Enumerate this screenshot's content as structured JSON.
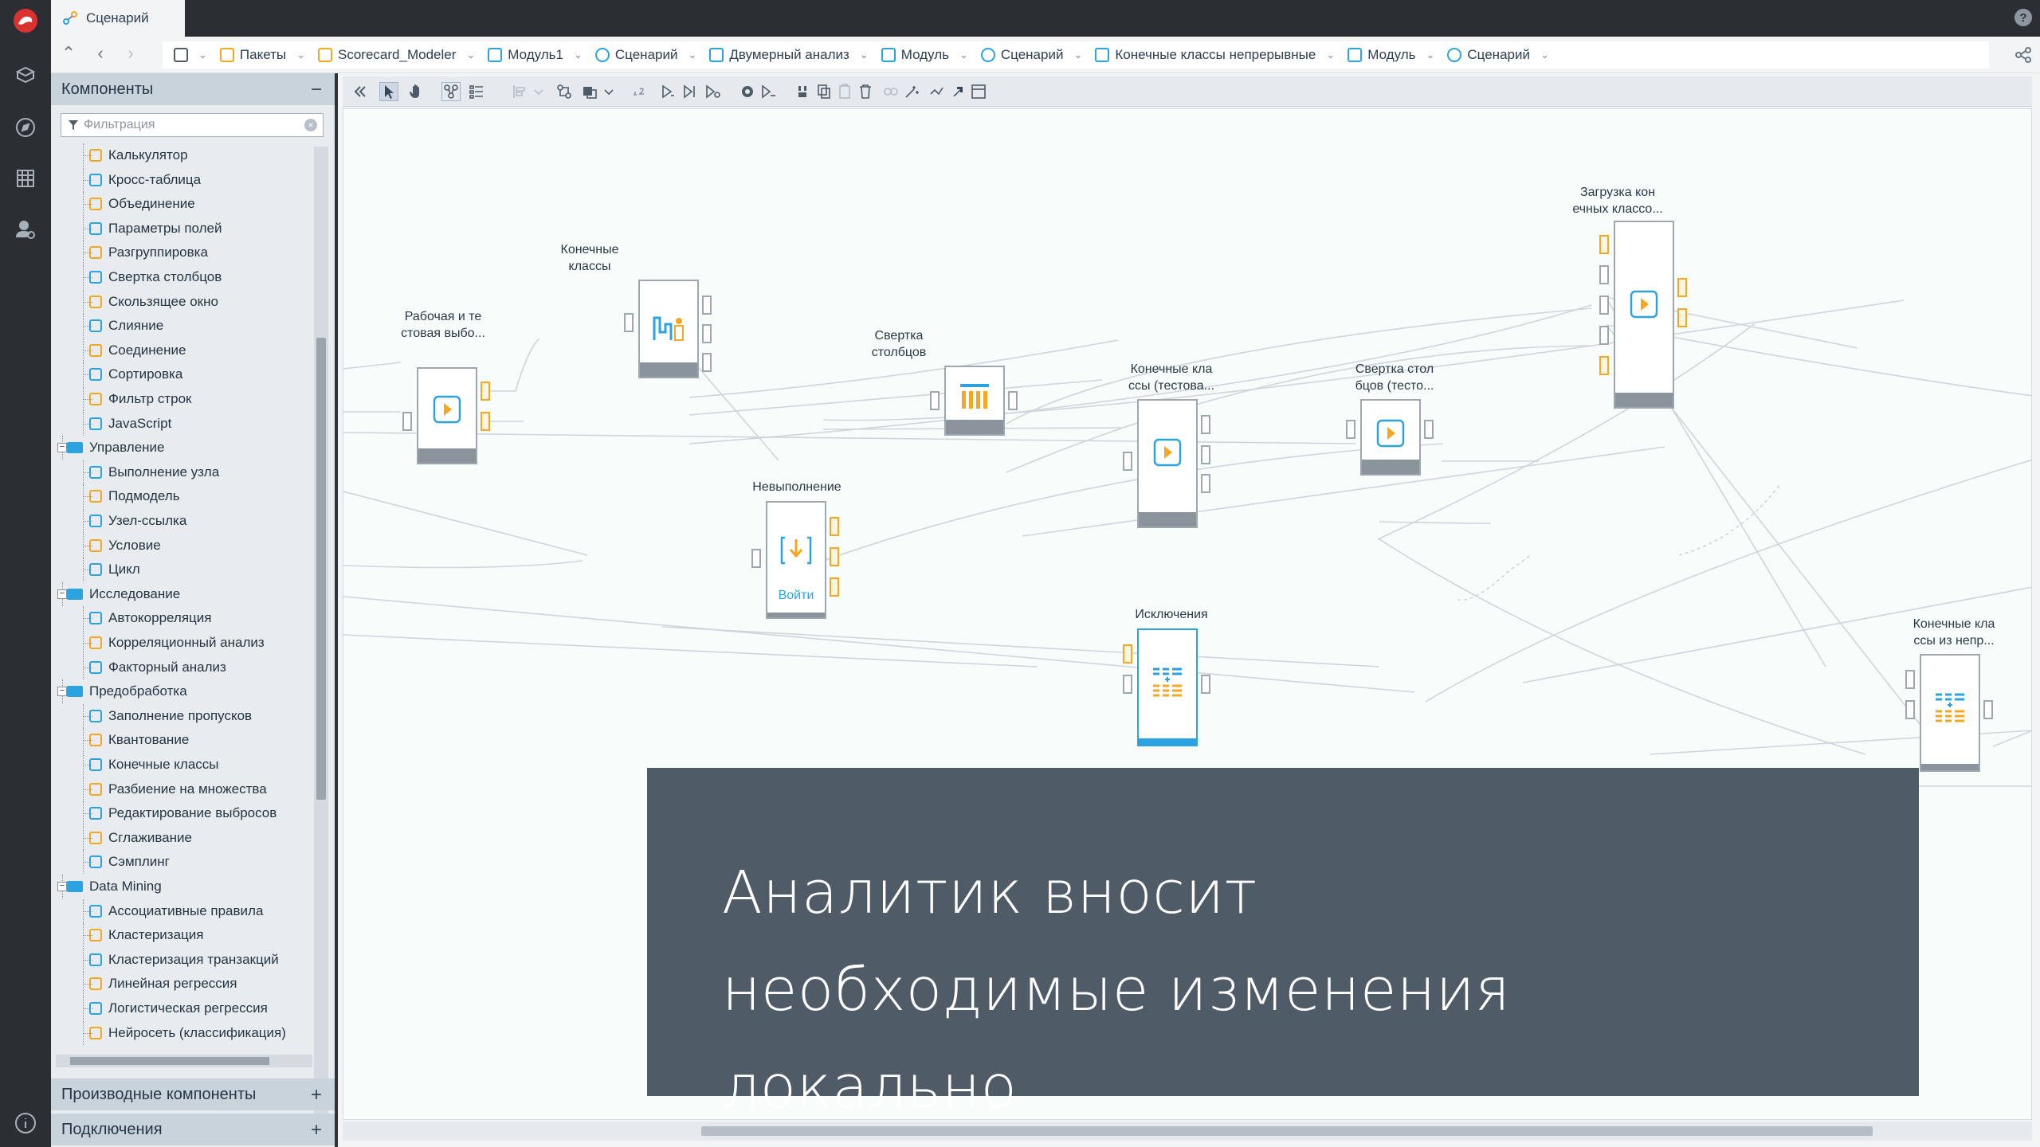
{
  "app": {
    "main_tab": "Сценарий",
    "help": "?"
  },
  "breadcrumb": [
    {
      "label": "",
      "icon": "hierarchy-icon"
    },
    {
      "label": "Пакеты",
      "icon": "package-icon"
    },
    {
      "label": "Scorecard_Modeler",
      "icon": "package-icon"
    },
    {
      "label": "Модуль1",
      "icon": "module-icon"
    },
    {
      "label": "Сценарий",
      "icon": "scenario-icon"
    },
    {
      "label": "Двумерный анализ",
      "icon": "module-icon"
    },
    {
      "label": "Модуль",
      "icon": "module-icon"
    },
    {
      "label": "Сценарий",
      "icon": "scenario-icon"
    },
    {
      "label": "Конечные классы непрерывные",
      "icon": "module-icon"
    },
    {
      "label": "Модуль",
      "icon": "module-icon"
    },
    {
      "label": "Сценарий",
      "icon": "scenario-icon"
    }
  ],
  "sidebar": {
    "components_title": "Компоненты",
    "collapse": "−",
    "filter_placeholder": "Фильтрация",
    "tree": [
      {
        "label": "Калькулятор",
        "level": 2,
        "icon": "calculator-icon"
      },
      {
        "label": "Кросс-таблица",
        "level": 2,
        "icon": "crosstab-icon"
      },
      {
        "label": "Объединение",
        "level": 2,
        "icon": "union-icon"
      },
      {
        "label": "Параметры полей",
        "level": 2,
        "icon": "field-params-icon"
      },
      {
        "label": "Разгруппировка",
        "level": 2,
        "icon": "ungroup-icon"
      },
      {
        "label": "Свертка столбцов",
        "level": 2,
        "icon": "columns-fold-icon"
      },
      {
        "label": "Скользящее окно",
        "level": 2,
        "icon": "sliding-window-icon"
      },
      {
        "label": "Слияние",
        "level": 2,
        "icon": "merge-icon"
      },
      {
        "label": "Соединение",
        "level": 2,
        "icon": "join-icon"
      },
      {
        "label": "Сортировка",
        "level": 2,
        "icon": "sort-icon"
      },
      {
        "label": "Фильтр строк",
        "level": 2,
        "icon": "filter-icon"
      },
      {
        "label": "JavaScript",
        "level": 2,
        "icon": "javascript-icon"
      },
      {
        "label": "Управление",
        "level": 1,
        "icon": "folder-icon"
      },
      {
        "label": "Выполнение узла",
        "level": 2,
        "icon": "execute-node-icon"
      },
      {
        "label": "Подмодель",
        "level": 2,
        "icon": "submodel-icon"
      },
      {
        "label": "Узел-ссылка",
        "level": 2,
        "icon": "link-node-icon"
      },
      {
        "label": "Условие",
        "level": 2,
        "icon": "condition-icon"
      },
      {
        "label": "Цикл",
        "level": 2,
        "icon": "loop-icon"
      },
      {
        "label": "Исследование",
        "level": 1,
        "icon": "folder-icon"
      },
      {
        "label": "Автокорреляция",
        "level": 2,
        "icon": "autocorrelation-icon"
      },
      {
        "label": "Корреляционный анализ",
        "level": 2,
        "icon": "correlation-icon"
      },
      {
        "label": "Факторный анализ",
        "level": 2,
        "icon": "factor-icon"
      },
      {
        "label": "Предобработка",
        "level": 1,
        "icon": "folder-icon"
      },
      {
        "label": "Заполнение пропусков",
        "level": 2,
        "icon": "fill-gaps-icon"
      },
      {
        "label": "Квантование",
        "level": 2,
        "icon": "quantization-icon"
      },
      {
        "label": "Конечные классы",
        "level": 2,
        "icon": "final-classes-icon"
      },
      {
        "label": "Разбиение на множества",
        "level": 2,
        "icon": "split-icon"
      },
      {
        "label": "Редактирование выбросов",
        "level": 2,
        "icon": "outliers-icon"
      },
      {
        "label": "Сглаживание",
        "level": 2,
        "icon": "smoothing-icon"
      },
      {
        "label": "Сэмплинг",
        "level": 2,
        "icon": "sampling-icon"
      },
      {
        "label": "Data Mining",
        "level": 1,
        "icon": "folder-icon"
      },
      {
        "label": "Ассоциативные правила",
        "level": 2,
        "icon": "association-icon"
      },
      {
        "label": "Кластеризация",
        "level": 2,
        "icon": "clustering-icon"
      },
      {
        "label": "Кластеризация транзакций",
        "level": 2,
        "icon": "transaction-clustering-icon"
      },
      {
        "label": "Линейная регрессия",
        "level": 2,
        "icon": "linear-regression-icon"
      },
      {
        "label": "Логистическая регрессия",
        "level": 2,
        "icon": "logistic-regression-icon"
      },
      {
        "label": "Нейросеть (классификация)",
        "level": 2,
        "icon": "neural-net-icon"
      }
    ],
    "derived_title": "Производные компоненты",
    "connections_title": "Подключения",
    "expand": "+"
  },
  "nodes": {
    "workset": "Рабочая и те\nстовая выбо...",
    "final_classes": "Конечные\nклассы",
    "fold_columns": "Свертка\nстолбцов",
    "final_classes_test": "Конечные кла\nссы (тестова...",
    "fold_columns_test": "Свертка стол\nбцов (тесто...",
    "load_final": "Загрузка кон\nечных классо...",
    "no_run": "Невыполнение",
    "no_run_button": "Войти",
    "exceptions": "Исключения",
    "final_from_cont": "Конечные кла\nссы из непр..."
  },
  "overlay": {
    "text": "Аналитик вносит необходимые изменения локально"
  },
  "colors": {
    "accent": "#2aa3e0",
    "orange": "#f5a623",
    "dark": "#2b2f34",
    "overlay": "#4f5c68"
  }
}
